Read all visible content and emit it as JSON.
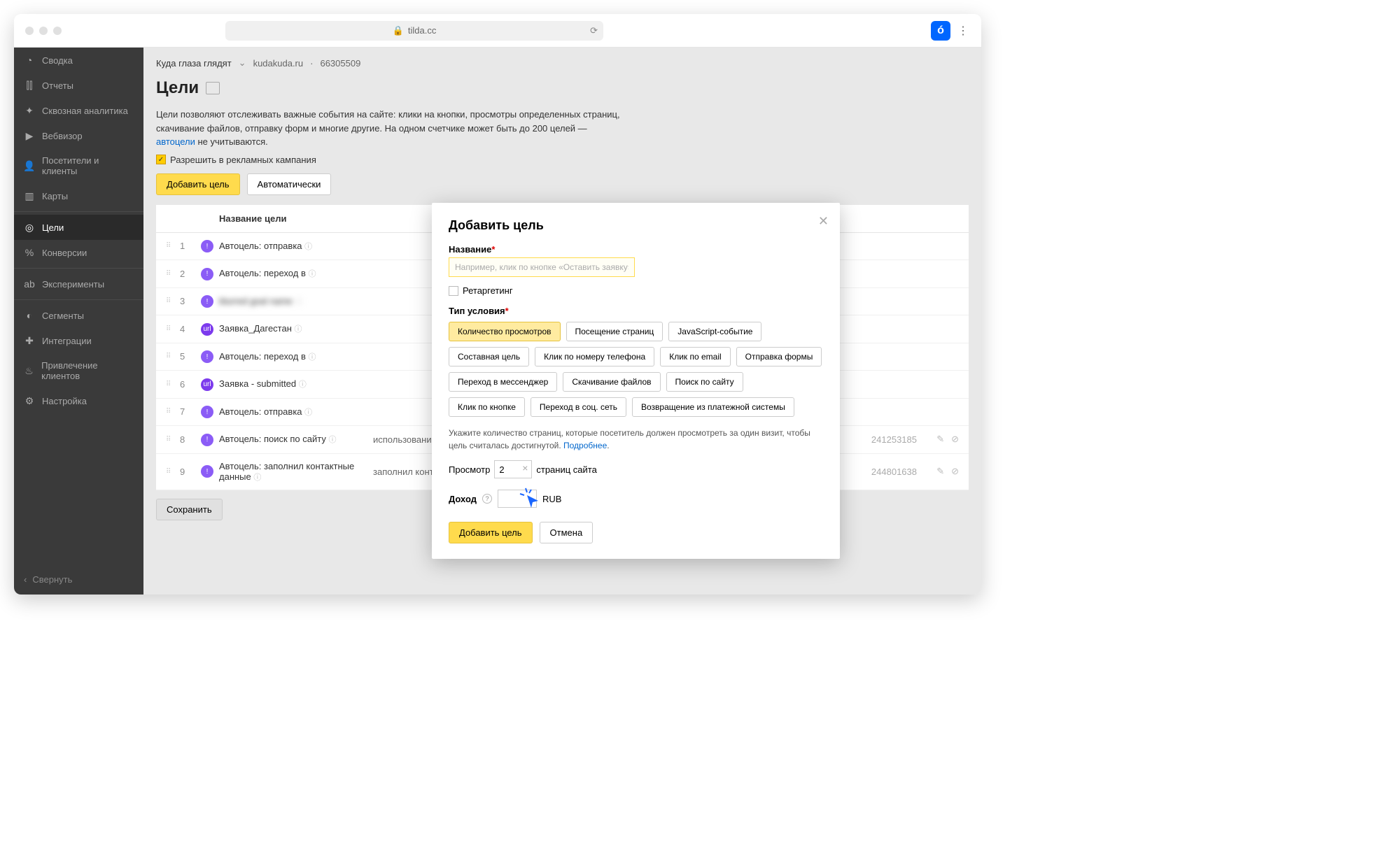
{
  "browser": {
    "url": "tilda.cc"
  },
  "sidebar": {
    "items": [
      {
        "icon": "clock-icon",
        "label": "Сводка"
      },
      {
        "icon": "bar-chart-icon",
        "label": "Отчеты"
      },
      {
        "icon": "sparkle-icon",
        "label": "Сквозная аналитика"
      },
      {
        "icon": "play-icon",
        "label": "Вебвизор"
      },
      {
        "icon": "person-icon",
        "label": "Посетители и клиенты"
      },
      {
        "icon": "cards-icon",
        "label": "Карты"
      },
      {
        "icon": "target-icon",
        "label": "Цели",
        "active": true
      },
      {
        "icon": "percent-icon",
        "label": "Конверсии"
      },
      {
        "icon": "ab-icon",
        "label": "Эксперименты"
      },
      {
        "icon": "pie-icon",
        "label": "Сегменты"
      },
      {
        "icon": "puzzle-icon",
        "label": "Интеграции"
      },
      {
        "icon": "flame-icon",
        "label": "Привлечение клиентов"
      },
      {
        "icon": "gear-icon",
        "label": "Настройка"
      }
    ],
    "collapse": "Свернуть"
  },
  "header": {
    "project": "Куда глаза глядят",
    "domain": "kudakuda.ru",
    "counter": "66305509"
  },
  "page": {
    "title": "Цели",
    "desc_1": "Цели позволяют отслеживать важные события на сайте: клики на кнопки, просмотры определенных страниц, скачивание файлов, отправку форм и многие другие. На одном счетчике может быть до 200 целей — ",
    "desc_link": "автоцели",
    "desc_2": " не учитываются.",
    "perm_label": "Разрешить в рекламных кампания",
    "add_btn": "Добавить цель",
    "auto_btn": "Автоматически",
    "col_name": "Название цели",
    "save_btn": "Сохранить"
  },
  "goals": [
    {
      "n": "1",
      "icon": "purple",
      "name": "Автоцель: отправка",
      "desc": "",
      "id": ""
    },
    {
      "n": "2",
      "icon": "purple",
      "name": "Автоцель: переход в",
      "desc": "",
      "id": ""
    },
    {
      "n": "3",
      "icon": "purple",
      "name": "blurred goal name",
      "desc": "",
      "id": "",
      "blur": true
    },
    {
      "n": "4",
      "icon": "url",
      "name": "Заявка_Дагестан",
      "desc": "",
      "id": ""
    },
    {
      "n": "5",
      "icon": "purple",
      "name": "Автоцель: переход в",
      "desc": "",
      "id": ""
    },
    {
      "n": "6",
      "icon": "url",
      "name": "Заявка - submitted",
      "desc": "",
      "id": ""
    },
    {
      "n": "7",
      "icon": "purple",
      "name": "Автоцель: отправка",
      "desc": "",
      "id": ""
    },
    {
      "n": "8",
      "icon": "purple",
      "name": "Автоцель: поиск по сайту",
      "desc": "использование поиска по сайту",
      "id": "241253185"
    },
    {
      "n": "9",
      "icon": "purple",
      "name": "Автоцель: заполнил контактные данные",
      "desc": "заполнил контактные данные",
      "id": "244801638"
    }
  ],
  "modal": {
    "title": "Добавить цель",
    "name_label": "Название",
    "name_placeholder": "Например, клик по кнопке «Оставить заявку»",
    "retarget_label": "Ретаргетинг",
    "type_label": "Тип условия",
    "types": [
      "Количество просмотров",
      "Посещение страниц",
      "JavaScript-событие",
      "Составная цель",
      "Клик по номеру телефона",
      "Клик по email",
      "Отправка формы",
      "Переход в мессенджер",
      "Скачивание файлов",
      "Поиск по сайту",
      "Клик по кнопке",
      "Переход в соц. сеть",
      "Возвращение из платежной системы"
    ],
    "help_1": "Укажите количество страниц, которые посетитель должен просмотреть за один визит, чтобы цель считалась достигнутой. ",
    "help_link": "Подробнее",
    "view_prefix": "Просмотр",
    "view_value": "2",
    "view_suffix": "страниц сайта",
    "income_label": "Доход",
    "income_currency": "RUB",
    "submit": "Добавить цель",
    "cancel": "Отмена"
  }
}
